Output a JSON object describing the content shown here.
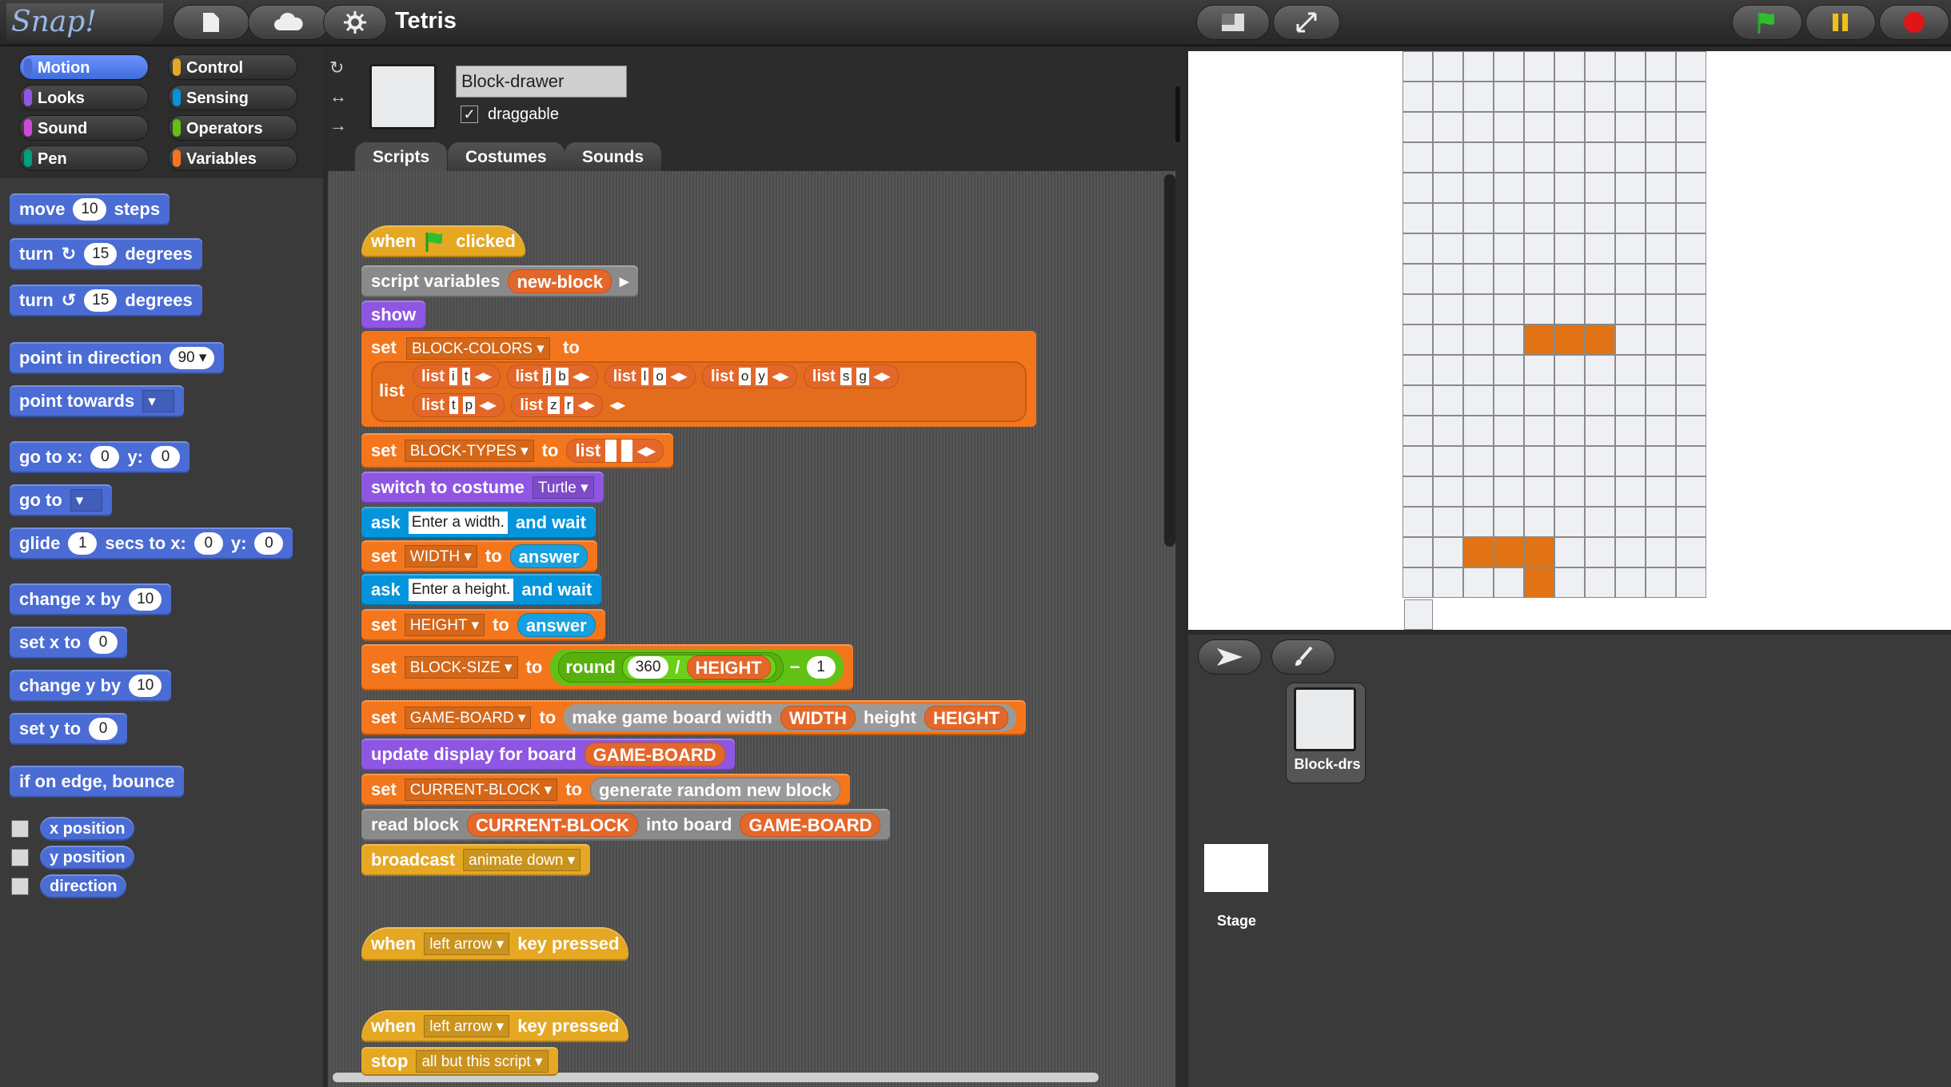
{
  "app": {
    "logo": "Snap!",
    "project_title": "Tetris"
  },
  "categories": [
    {
      "label": "Motion",
      "color": "#4a6cd4"
    },
    {
      "label": "Control",
      "color": "#e6a822"
    },
    {
      "label": "Looks",
      "color": "#8f56e3"
    },
    {
      "label": "Sensing",
      "color": "#0494dc"
    },
    {
      "label": "Sound",
      "color": "#cf4ad9"
    },
    {
      "label": "Operators",
      "color": "#62c213"
    },
    {
      "label": "Pen",
      "color": "#00a178"
    },
    {
      "label": "Variables",
      "color": "#f3761d"
    }
  ],
  "palette": {
    "move": {
      "a": "move",
      "v": "10",
      "b": "steps"
    },
    "turn_cw": {
      "a": "turn",
      "icon": "↻",
      "v": "15",
      "b": "degrees"
    },
    "turn_ccw": {
      "a": "turn",
      "icon": "↺",
      "v": "15",
      "b": "degrees"
    },
    "point_dir": {
      "a": "point in direction",
      "v": "90"
    },
    "point_towards": {
      "a": "point towards"
    },
    "goto_xy": {
      "a": "go to x:",
      "x": "0",
      "b": "y:",
      "y": "0"
    },
    "goto": {
      "a": "go to"
    },
    "glide": {
      "a": "glide",
      "s": "1",
      "b": "secs to x:",
      "x": "0",
      "c": "y:",
      "y": "0"
    },
    "change_x": {
      "a": "change x by",
      "v": "10"
    },
    "set_x": {
      "a": "set x to",
      "v": "0"
    },
    "change_y": {
      "a": "change y by",
      "v": "10"
    },
    "set_y": {
      "a": "set y to",
      "v": "0"
    },
    "bounce": {
      "a": "if on edge, bounce"
    },
    "reporters": [
      "x position",
      "y position",
      "direction"
    ]
  },
  "sprite": {
    "name": "Block-drawer",
    "draggable_label": "draggable",
    "draggable": true
  },
  "tabs": [
    "Scripts",
    "Costumes",
    "Sounds"
  ],
  "scripts": {
    "hat1": {
      "a": "when",
      "b": "clicked"
    },
    "script_vars": {
      "a": "script variables",
      "v": "new-block"
    },
    "show": "show",
    "set_colors": {
      "a": "set",
      "var": "BLOCK-COLORS",
      "b": "to",
      "list": "list",
      "row1": [
        [
          "i",
          "t"
        ],
        [
          "j",
          "b"
        ],
        [
          "l",
          "o"
        ],
        [
          "o",
          "y"
        ],
        [
          "s",
          "g"
        ]
      ],
      "row2": [
        [
          "t",
          "p"
        ],
        [
          "z",
          "r"
        ]
      ]
    },
    "set_types": {
      "a": "set",
      "var": "BLOCK-TYPES",
      "b": "to",
      "list": "list"
    },
    "costume": {
      "a": "switch to costume",
      "v": "Turtle"
    },
    "ask_w": {
      "a": "ask",
      "v": "Enter a width.",
      "b": "and wait"
    },
    "set_w": {
      "a": "set",
      "var": "WIDTH",
      "b": "to",
      "v": "answer"
    },
    "ask_h": {
      "a": "ask",
      "v": "Enter a height.",
      "b": "and wait"
    },
    "set_h": {
      "a": "set",
      "var": "HEIGHT",
      "b": "to",
      "v": "answer"
    },
    "set_size": {
      "a": "set",
      "var": "BLOCK-SIZE",
      "b": "to",
      "round": "round",
      "n": "360",
      "slash": "/",
      "d": "HEIGHT",
      "minus": "−",
      "m": "1"
    },
    "set_board": {
      "a": "set",
      "var": "GAME-BOARD",
      "b": "to",
      "c": "make game board width",
      "w": "WIDTH",
      "h_lbl": "height",
      "h": "HEIGHT"
    },
    "update": {
      "a": "update display for board",
      "v": "GAME-BOARD"
    },
    "set_current": {
      "a": "set",
      "var": "CURRENT-BLOCK",
      "b": "to",
      "c": "generate random new block"
    },
    "read": {
      "a": "read block",
      "v": "CURRENT-BLOCK",
      "b": "into board",
      "w": "GAME-BOARD"
    },
    "broadcast": {
      "a": "broadcast",
      "v": "animate down"
    },
    "hat2": {
      "a": "when",
      "v": "left arrow",
      "b": "key pressed"
    },
    "hat3": {
      "a": "when",
      "v": "left arrow",
      "b": "key pressed"
    },
    "stop": {
      "a": "stop",
      "v": "all but this script"
    }
  },
  "corral": {
    "sprite_label": "Block-drs",
    "stage_label": "Stage"
  },
  "board": {
    "cols": 10,
    "rows": 18,
    "filled": [
      [
        9,
        4
      ],
      [
        9,
        5
      ],
      [
        9,
        6
      ],
      [
        16,
        2
      ],
      [
        16,
        3
      ],
      [
        16,
        4
      ],
      [
        17,
        4
      ]
    ],
    "fill_color": "#e27314",
    "empty_color": "#eef0f3"
  }
}
